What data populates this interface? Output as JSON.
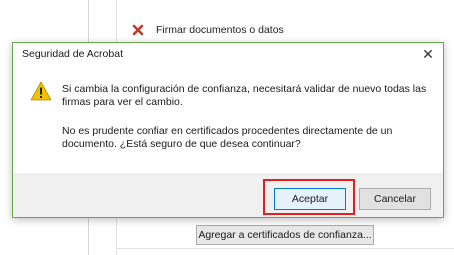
{
  "background": {
    "sign_item_label": "Firmar documentos o datos",
    "trust_button_label": "Agregar a certificados de confianza..."
  },
  "dialog": {
    "title": "Seguridad de Acrobat",
    "close_glyph": "✕",
    "message_1": "Si cambia la configuración de confianza, necesitará validar de nuevo todas las firmas para ver el cambio.",
    "message_2": "No es prudente confiar en certificados procedentes directamente de un documento. ¿Está seguro de que desea continuar?",
    "ok_label": "Aceptar",
    "cancel_label": "Cancelar",
    "icon": "warning-icon"
  },
  "colors": {
    "dialog_border": "#67a84d",
    "highlight": "#e02020",
    "warning_fill": "#f2c200",
    "x_icon": "#c0392b"
  }
}
